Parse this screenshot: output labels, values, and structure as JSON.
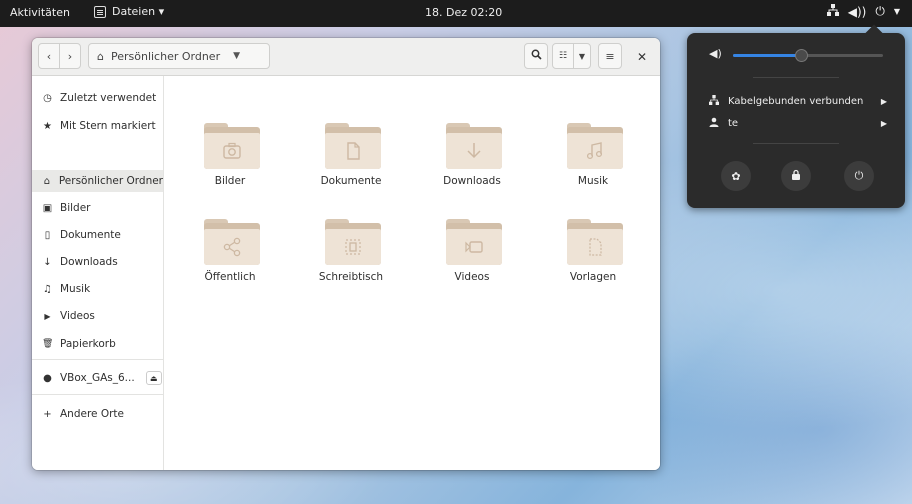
{
  "topbar": {
    "activities": "Aktivitäten",
    "app_menu": "Dateien ▾",
    "clock": "18. Dez 02:20",
    "status_icons": [
      "network-wired-icon",
      "volume-icon",
      "power-icon"
    ]
  },
  "window": {
    "path_label": "Persönlicher Ordner",
    "sidebar": {
      "items": [
        {
          "label": "Zuletzt verwendet",
          "icon": "◷"
        },
        {
          "label": "Mit Stern markiert",
          "icon": "★"
        },
        {
          "label": "Persönlicher Ordner",
          "icon": "⌂"
        },
        {
          "label": "Bilder",
          "icon": "▣"
        },
        {
          "label": "Dokumente",
          "icon": "▯"
        },
        {
          "label": "Downloads",
          "icon": "↓"
        },
        {
          "label": "Musik",
          "icon": "♫"
        },
        {
          "label": "Videos",
          "icon": "▶"
        },
        {
          "label": "Papierkorb",
          "icon": "🗑"
        }
      ],
      "device": "VBox_GAs_6...",
      "other_places": "Andere Orte"
    },
    "folders": [
      {
        "label": "Bilder"
      },
      {
        "label": "Dokumente"
      },
      {
        "label": "Downloads"
      },
      {
        "label": "Musik"
      },
      {
        "label": "Öffentlich"
      },
      {
        "label": "Schreibtisch"
      },
      {
        "label": "Videos"
      },
      {
        "label": "Vorlagen"
      }
    ]
  },
  "system_menu": {
    "volume_level": 0.45,
    "network_label": "Kabelgebunden verbunden",
    "user_label": "te"
  },
  "colors": {
    "topbar": "#1c1c1c",
    "folder": "#eee3d6",
    "accent": "#3584e4",
    "menu_bg": "#2b2b2b"
  }
}
